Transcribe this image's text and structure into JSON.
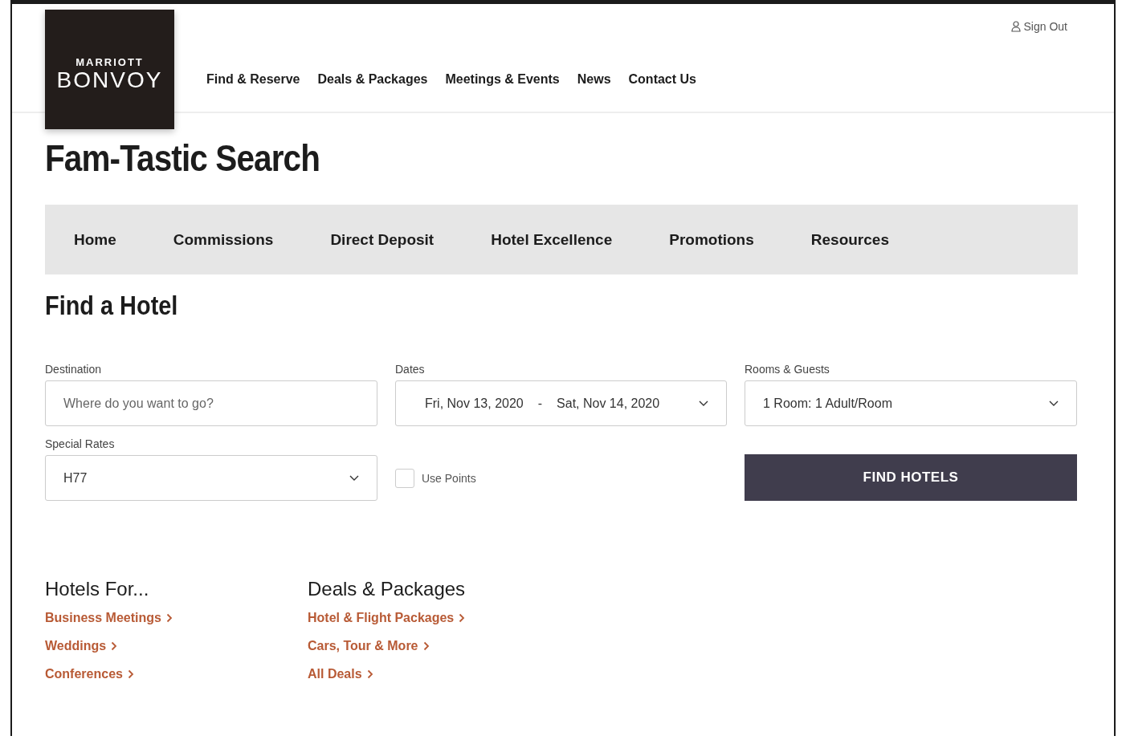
{
  "header": {
    "logo": {
      "top": "MARRIOTT",
      "bottom": "BONVOY"
    },
    "nav": [
      "Find & Reserve",
      "Deals & Packages",
      "Meetings & Events",
      "News",
      "Contact Us"
    ],
    "sign_out": "Sign Out"
  },
  "page_title": "Fam-Tastic Search",
  "tabs": [
    {
      "label": "Home",
      "selected": false
    },
    {
      "label": "Commissions",
      "selected": false
    },
    {
      "label": "Direct Deposit",
      "selected": false
    },
    {
      "label": "Hotel Excellence",
      "selected": false
    },
    {
      "label": "Promotions",
      "selected": false
    },
    {
      "label": "Resources",
      "selected": false
    }
  ],
  "search": {
    "title": "Find a Hotel",
    "destination": {
      "label": "Destination",
      "placeholder": "Where do you want to go?"
    },
    "dates": {
      "label": "Dates",
      "start": "Fri, Nov 13, 2020",
      "separator": "-",
      "end": "Sat, Nov 14, 2020"
    },
    "rooms": {
      "label": "Rooms & Guests",
      "value": "1 Room: 1 Adult/Room"
    },
    "special_rates": {
      "label": "Special Rates",
      "value": "H77"
    },
    "use_points": {
      "label": "Use Points",
      "checked": false
    },
    "button": "FIND HOTELS"
  },
  "link_groups": [
    {
      "heading": "Hotels For...",
      "links": [
        "Business Meetings",
        "Weddings",
        "Conferences"
      ]
    },
    {
      "heading": "Deals & Packages",
      "links": [
        "Hotel & Flight Packages",
        "Cars, Tour & More",
        "All Deals"
      ]
    }
  ]
}
